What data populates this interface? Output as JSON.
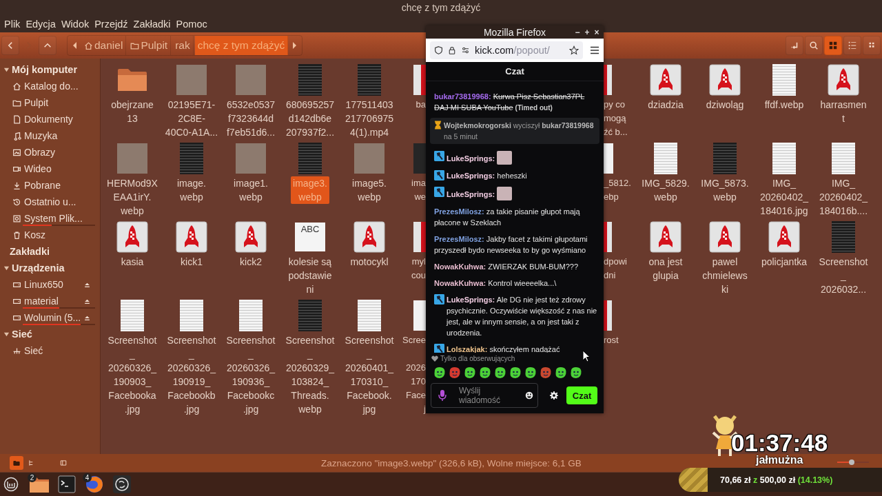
{
  "window": {
    "title": "chcę z tym zdążyć"
  },
  "menu": [
    "Plik",
    "Edycja",
    "Widok",
    "Przejdź",
    "Zakładki",
    "Pomoc"
  ],
  "toolbar": {
    "nav_buttons": [
      {
        "disabled": false
      },
      {
        "disabled": true
      },
      {
        "disabled": false
      }
    ],
    "breadcrumb": [
      {
        "label": "daniel",
        "selected": false
      },
      {
        "label": "Pulpit",
        "selected": false
      },
      {
        "label": "rak",
        "selected": false
      },
      {
        "label": "chcę z tym zdążyć",
        "selected": true
      }
    ],
    "view_modes": [
      {
        "selected": true
      },
      {
        "selected": false
      },
      {
        "selected": false
      }
    ]
  },
  "sidebar": {
    "sections": [
      {
        "title": "Mój komputer",
        "expanded": true,
        "items": [
          {
            "label": "Katalog do..."
          },
          {
            "label": "Pulpit"
          },
          {
            "label": "Dokumenty"
          },
          {
            "label": "Muzyka"
          },
          {
            "label": "Obrazy"
          },
          {
            "label": "Wideo"
          },
          {
            "label": "Pobrane"
          },
          {
            "label": "Ostatnio u..."
          },
          {
            "label": "System Plik...",
            "level": 0.4
          },
          {
            "label": "Kosz"
          }
        ]
      },
      {
        "title": "Zakładki"
      },
      {
        "title": "Urządzenia",
        "expanded": true,
        "items": [
          {
            "label": "Linux650",
            "eject": true
          },
          {
            "label": "material",
            "eject": true,
            "level": 0.5
          },
          {
            "label": "Wolumin (5...",
            "eject": true,
            "level": 0.8
          }
        ]
      },
      {
        "title": "Sieć",
        "expanded": true,
        "items": [
          {
            "label": "Sieć"
          }
        ]
      }
    ]
  },
  "file_grid": {
    "rows": [
      {
        "items": [
          {
            "kind": "folder",
            "label": "obejrzane\n13",
            "selected": false
          },
          {
            "kind": "photo",
            "label": "02195E71-\n2C8E-\n40C0-A1A...",
            "selected": false
          },
          {
            "kind": "photo",
            "label": "6532e0537\nf7323644d\nf7eb51d6...",
            "selected": false
          },
          {
            "kind": "dark",
            "label": "680695257\nd142db6e\n207937f2...",
            "selected": false
          },
          {
            "kind": "dark",
            "label": "177511403\n217706975\n4(1).mp4",
            "selected": false
          },
          {
            "kind": "rocket",
            "label": "ba",
            "selected": false
          },
          {
            "kind": "rocket",
            "label": "py co\nmogą\nźć b...",
            "selected": false
          },
          {
            "kind": "rocket",
            "label": "dziadzia",
            "selected": false
          },
          {
            "kind": "rocket",
            "label": "dziwoląg",
            "selected": false
          },
          {
            "kind": "page",
            "label": "ffdf.webp",
            "selected": false
          },
          {
            "kind": "rocket",
            "label": "harrasmen\nt",
            "selected": false
          }
        ]
      },
      {
        "items": [
          {
            "kind": "photo",
            "label": "HERMod9X\nEAA1irY.\nwebp",
            "selected": false
          },
          {
            "kind": "dark",
            "label": "image.\nwebp",
            "selected": false
          },
          {
            "kind": "photo",
            "label": "image1.\nwebp",
            "selected": false
          },
          {
            "kind": "dark",
            "label": "image3.\nwebp",
            "selected": true
          },
          {
            "kind": "photo",
            "label": "image5.\nwebp",
            "selected": false
          },
          {
            "kind": "dark",
            "label": "ima\nwe",
            "selected": false
          },
          {
            "kind": "page",
            "label": "_5812.\nebp",
            "selected": false
          },
          {
            "kind": "page",
            "label": "IMG_5829.\nwebp",
            "selected": false
          },
          {
            "kind": "dark",
            "label": "IMG_5873.\nwebp",
            "selected": false
          },
          {
            "kind": "page",
            "label": "IMG_\n20260402_\n184016.jpg",
            "selected": false
          },
          {
            "kind": "page",
            "label": "IMG_\n20260402_\n184016b....",
            "selected": false
          }
        ]
      },
      {
        "items": [
          {
            "kind": "rocket",
            "label": "kasia",
            "selected": false
          },
          {
            "kind": "rocket",
            "label": "kick1",
            "selected": false
          },
          {
            "kind": "rocket",
            "label": "kick2",
            "selected": false
          },
          {
            "kind": "text",
            "glyph": "ABC",
            "label": "kolesie są\npodstawie\nni",
            "selected": false
          },
          {
            "kind": "rocket",
            "label": "motocykl",
            "selected": false
          },
          {
            "kind": "rocket",
            "label": "myl\ncou",
            "selected": false
          },
          {
            "kind": "rocket",
            "label": "dpowi\ndni",
            "selected": false
          },
          {
            "kind": "rocket",
            "label": "ona jest\nglupia",
            "selected": false
          },
          {
            "kind": "rocket",
            "label": "pawel\nchmielews\nki",
            "selected": false
          },
          {
            "kind": "rocket",
            "label": "policjantka",
            "selected": false
          },
          {
            "kind": "dark",
            "label": "Screenshot\n_\n2026032...",
            "selected": false
          }
        ]
      },
      {
        "items": [
          {
            "kind": "page",
            "label": "Screenshot\n_\n20260326_\n190903_\nFacebooka\n.jpg",
            "selected": false
          },
          {
            "kind": "page",
            "label": "Screenshot\n_\n20260326_\n190919_\nFacebookb\n.jpg",
            "selected": false
          },
          {
            "kind": "page",
            "label": "Screenshot\n_\n20260326_\n190936_\nFacebookc\n.jpg",
            "selected": false
          },
          {
            "kind": "dark",
            "label": "Screenshot\n_\n20260329_\n103824_\nThreads.\nwebp",
            "selected": false
          },
          {
            "kind": "page",
            "label": "Screenshot\n_\n20260401_\n170310_\nFacebook.\njpg",
            "selected": false
          },
          {
            "kind": "page",
            "label": "Scree\n\n2026\n170\nFace\nj",
            "selected": false
          },
          {
            "kind": "rocket",
            "label": "rost",
            "selected": false
          }
        ]
      }
    ]
  },
  "status_bar": {
    "view_buttons": [
      {
        "selected": true
      },
      {
        "selected": false
      },
      {
        "selected": false
      }
    ],
    "text": "Zaznaczono \"image3.webp\" (326,6 kB), Wolne miejsce: 6,1 GB"
  },
  "taskbar": {
    "file_manager_badge": "2",
    "browser_badge": "4"
  },
  "browser": {
    "title": "Mozilla Firefox",
    "controls": [
      "−",
      "+",
      "×"
    ],
    "url": {
      "host": "kick.com",
      "path": "/popout/"
    }
  },
  "chat": {
    "title": "Czat",
    "messages": [
      {
        "kind": "timed_out",
        "user": "bukar73819968:",
        "color": "#a66cf0",
        "badge": false,
        "text": "Kurwa Pisz Sebastian37PL DAJ MI SUBA YouTube",
        "note": "(Timed out)"
      },
      {
        "kind": "mod_action",
        "text": "**Wojtekmokrogorski** wyciszył **bukar73819968** na 5 minut"
      },
      {
        "kind": "emote",
        "user": "LukeSprings:",
        "color": "#f2cde2",
        "badge": true
      },
      {
        "kind": "text",
        "user": "LukeSprings:",
        "color": "#f2cde2",
        "badge": true,
        "text": "heheszki"
      },
      {
        "kind": "emote",
        "user": "LukeSprings:",
        "color": "#f2cde2",
        "badge": true
      },
      {
        "kind": "text",
        "user": "PrezesMilosz:",
        "color": "#80a2e2",
        "badge": false,
        "text": "za takie pisanie głupot mają płacone w Szeklach"
      },
      {
        "kind": "text",
        "user": "PrezesMilosz:",
        "color": "#80a2e2",
        "badge": false,
        "text": "Jakby facet z takimi głupotami przyszedł bydo newseeka to by go wyśmiano"
      },
      {
        "kind": "text",
        "user": "NowakKuhwa:",
        "color": "#e8bccf",
        "badge": false,
        "text": "ZWIERZAK BUM-BUM???"
      },
      {
        "kind": "text",
        "user": "NowakKuhwa:",
        "color": "#e8bccf",
        "badge": false,
        "text": "Kontrol wieeeelka...\\"
      },
      {
        "kind": "text",
        "user": "LukeSprings:",
        "color": "#f2cde2",
        "badge": true,
        "text": "Ale DG nie jest też zdrowy psychicznie. Oczywiście większość z nas nie jest, ale w innym sensie, a on jest taki z urodzenia."
      },
      {
        "kind": "text",
        "user": "Lolszakjak:",
        "color": "#f0c48c",
        "badge": true,
        "text": "skończyłem nadążać"
      }
    ],
    "followers_only": "Tylko dla obserwujących",
    "input": {
      "placeholder": "Wyślij wiadomość"
    },
    "send_button": "Czat"
  },
  "stream_overlay": {
    "timer": "01:37:48",
    "label": "jałmużna",
    "slider": {
      "level": 0.45
    },
    "donation": {
      "level": 0.1413,
      "raised": "70,66 zł",
      "separator": "z",
      "goal": "500,00 zł",
      "percent": "(14.13%)"
    }
  }
}
